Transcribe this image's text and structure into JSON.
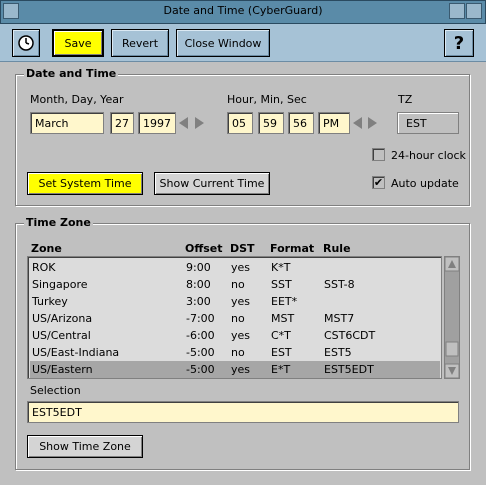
{
  "window": {
    "title": "Date and Time (CyberGuard)"
  },
  "toolbar": {
    "clock_icon": "clock-icon",
    "save_label": "Save",
    "revert_label": "Revert",
    "close_label": "Close Window",
    "help_label": "?"
  },
  "date_time": {
    "section_title": "Date and Time",
    "date_label": "Month, Day, Year",
    "time_label": "Hour, Min, Sec",
    "tz_label": "TZ",
    "month": "March",
    "day": "27",
    "year": "1997",
    "hour": "05",
    "min": "59",
    "sec": "56",
    "ampm": "PM",
    "tz": "EST",
    "clock24_label": "24-hour clock",
    "clock24_checked": false,
    "auto_update_label": "Auto update",
    "auto_update_checked": true,
    "check_mark": "✔",
    "set_system_time_label": "Set System Time",
    "show_current_time_label": "Show Current Time"
  },
  "timezone": {
    "section_title": "Time Zone",
    "columns": [
      "Zone",
      "Offset",
      "DST",
      "Format",
      "Rule"
    ],
    "rows": [
      {
        "zone": "ROK",
        "offset": "9:00",
        "dst": "yes",
        "format": "K*T",
        "rule": ""
      },
      {
        "zone": "Singapore",
        "offset": "8:00",
        "dst": "no",
        "format": "SST",
        "rule": "SST-8"
      },
      {
        "zone": "Turkey",
        "offset": "3:00",
        "dst": "yes",
        "format": "EET*",
        "rule": ""
      },
      {
        "zone": "US/Arizona",
        "offset": "-7:00",
        "dst": "no",
        "format": "MST",
        "rule": "MST7"
      },
      {
        "zone": "US/Central",
        "offset": "-6:00",
        "dst": "yes",
        "format": "C*T",
        "rule": "CST6CDT"
      },
      {
        "zone": "US/East-Indiana",
        "offset": "-5:00",
        "dst": "no",
        "format": "EST",
        "rule": "EST5"
      },
      {
        "zone": "US/Eastern",
        "offset": "-5:00",
        "dst": "yes",
        "format": "E*T",
        "rule": "EST5EDT"
      }
    ],
    "selected_index": 6,
    "selection_label": "Selection",
    "selection_value": "EST5EDT",
    "show_tz_label": "Show Time Zone"
  }
}
